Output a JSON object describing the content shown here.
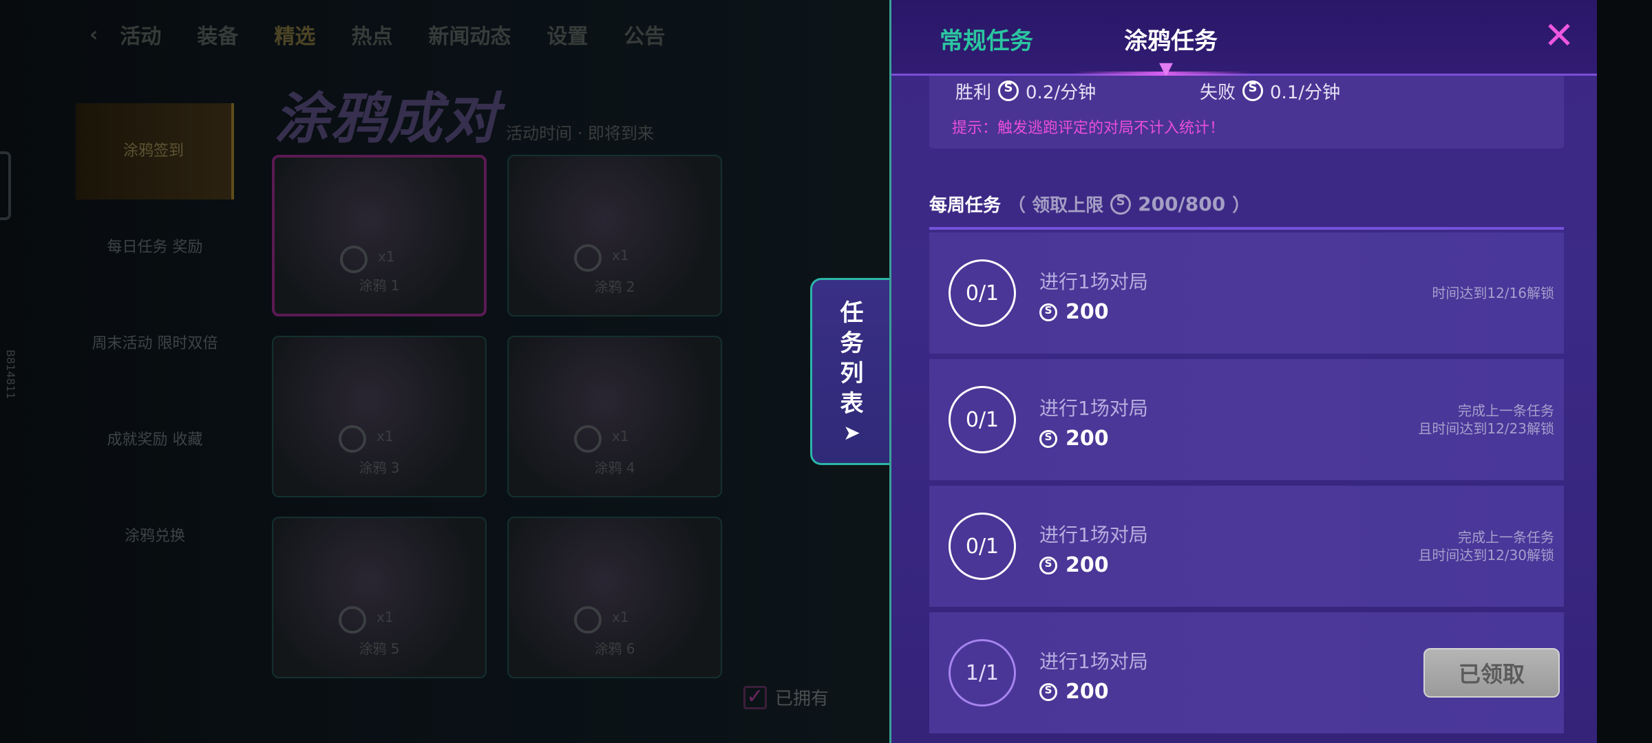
{
  "background": {
    "nav": {
      "back_icon": "back-chevron-icon",
      "items": [
        "活动",
        "装备",
        "精选",
        "热点",
        "新闻动态",
        "设置",
        "公告"
      ]
    },
    "banner": "涂鸦成对",
    "subtitle": "活动时间 · 即将到来",
    "sidebar": [
      "涂鸦签到",
      "每日任务 奖励",
      "周末活动 限时双倍",
      "成就奖励 收藏",
      "涂鸦兑换"
    ],
    "cards": [
      {
        "label": "涂鸦 1",
        "count": "x1"
      },
      {
        "label": "涂鸦 2",
        "count": "x1"
      },
      {
        "label": "涂鸦 3",
        "count": "x1"
      },
      {
        "label": "涂鸦 4",
        "count": "x1"
      },
      {
        "label": "涂鸦 5",
        "count": "x1"
      },
      {
        "label": "涂鸦 6",
        "count": "x1"
      }
    ],
    "checkbox_label": "已拥有",
    "side_vertical_text": "B814811"
  },
  "task_tab": {
    "chars": [
      "任",
      "务",
      "列",
      "表"
    ],
    "arrow_icon": "send-arrow-icon"
  },
  "panel": {
    "tabs": {
      "normal": "常规任务",
      "graffiti": "涂鸦任务",
      "active": "graffiti"
    },
    "close_icon": "close-x-icon",
    "rates": {
      "win_label": "胜利",
      "win_value": "0.2/分钟",
      "lose_label": "失败",
      "lose_value": "0.1/分钟"
    },
    "hint": "提示：触发逃跑评定的对局不计入统计！",
    "weekly": {
      "title": "每周任务",
      "limit_prefix": "（ 领取上限",
      "limit_value": "200/800",
      "limit_suffix": "）"
    },
    "tasks": [
      {
        "progress": "0/1",
        "name": "进行1场对局",
        "reward": "200",
        "status": "时间达到12/16解锁",
        "claimed": false
      },
      {
        "progress": "0/1",
        "name": "进行1场对局",
        "reward": "200",
        "status": "完成上一条任务\n且时间达到12/23解锁",
        "claimed": false
      },
      {
        "progress": "0/1",
        "name": "进行1场对局",
        "reward": "200",
        "status": "完成上一条任务\n且时间达到12/30解锁",
        "claimed": false
      },
      {
        "progress": "1/1",
        "name": "进行1场对局",
        "reward": "200",
        "status": "",
        "claimed": true,
        "claimed_label": "已领取"
      }
    ]
  },
  "colors": {
    "panel_bg": "#3b2a86",
    "tab_active": "#ffffff",
    "tab_inactive": "#2bc6a0",
    "hint": "#e94fd8",
    "close": "#ee57e0",
    "accent_border": "#2bb6a8"
  }
}
